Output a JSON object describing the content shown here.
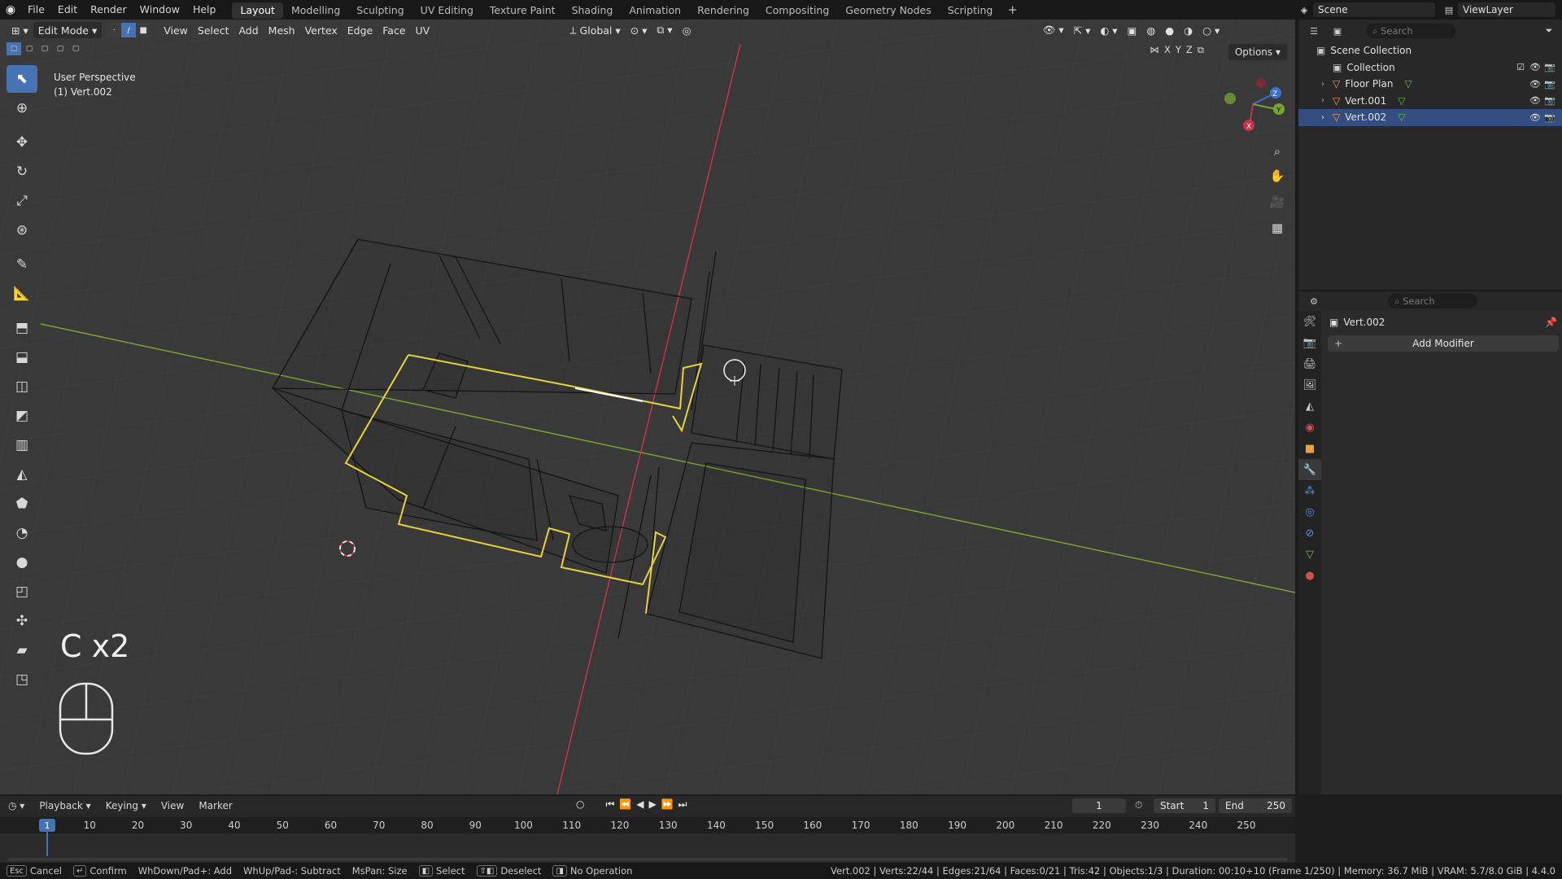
{
  "menu": [
    "File",
    "Edit",
    "Render",
    "Window",
    "Help"
  ],
  "workspaces": [
    "Layout",
    "Modelling",
    "Sculpting",
    "UV Editing",
    "Texture Paint",
    "Shading",
    "Animation",
    "Rendering",
    "Compositing",
    "Geometry Nodes",
    "Scripting"
  ],
  "active_workspace": "Layout",
  "scene_name": "Scene",
  "view_layer": "ViewLayer",
  "viewport": {
    "mode": "Edit Mode",
    "header_menus": [
      "View",
      "Select",
      "Add",
      "Mesh",
      "Vertex",
      "Edge",
      "Face",
      "UV"
    ],
    "transform_orientation": "Global",
    "options_label": "Options",
    "axes": [
      "X",
      "Y",
      "Z"
    ],
    "perspective": "User Perspective",
    "object_info": "(1) Vert.002",
    "key_overlay": "C x2",
    "gizmo_axes": [
      "X",
      "Y",
      "Z"
    ]
  },
  "outliner": {
    "search_placeholder": "Search",
    "root": "Scene Collection",
    "collection": "Collection",
    "items": [
      {
        "name": "Floor Plan",
        "selected": false
      },
      {
        "name": "Vert.001",
        "selected": false
      },
      {
        "name": "Vert.002",
        "selected": true
      }
    ]
  },
  "properties": {
    "search_placeholder": "Search",
    "object_name": "Vert.002",
    "add_modifier": "Add Modifier"
  },
  "timeline": {
    "menus": [
      "Playback",
      "Keying",
      "View",
      "Marker"
    ],
    "current_frame": "1",
    "start_label": "Start",
    "start_value": "1",
    "end_label": "End",
    "end_value": "250",
    "ticks": [
      "1",
      "10",
      "20",
      "30",
      "40",
      "50",
      "60",
      "70",
      "80",
      "90",
      "100",
      "110",
      "120",
      "130",
      "140",
      "150",
      "160",
      "170",
      "180",
      "190",
      "200",
      "210",
      "220",
      "230",
      "240",
      "250"
    ]
  },
  "statusbar": {
    "hints": [
      {
        "key": "Esc",
        "label": "Cancel"
      },
      {
        "key": "↵",
        "label": "Confirm"
      },
      {
        "key": "",
        "label": "WhDown/Pad+: Add"
      },
      {
        "key": "",
        "label": "WhUp/Pad-: Subtract"
      },
      {
        "key": "",
        "label": "MsPan: Size"
      },
      {
        "key": "◧",
        "label": "Select"
      },
      {
        "key": "⇧◧",
        "label": "Deselect"
      },
      {
        "key": "◨",
        "label": "No Operation"
      }
    ],
    "stats": "Vert.002 | Verts:22/44 | Edges:21/64 | Faces:0/21 | Tris:42 | Objects:1/3 | Duration: 00:10+10 (Frame 1/250) | Memory: 36.7 MiB | VRAM: 5.7/8.0 GiB | 4.4.0"
  },
  "colors": {
    "selected_edge": "#e8d43a",
    "x_axis": "#c8334a",
    "y_axis": "#7aa330",
    "accent": "#4772b3"
  }
}
